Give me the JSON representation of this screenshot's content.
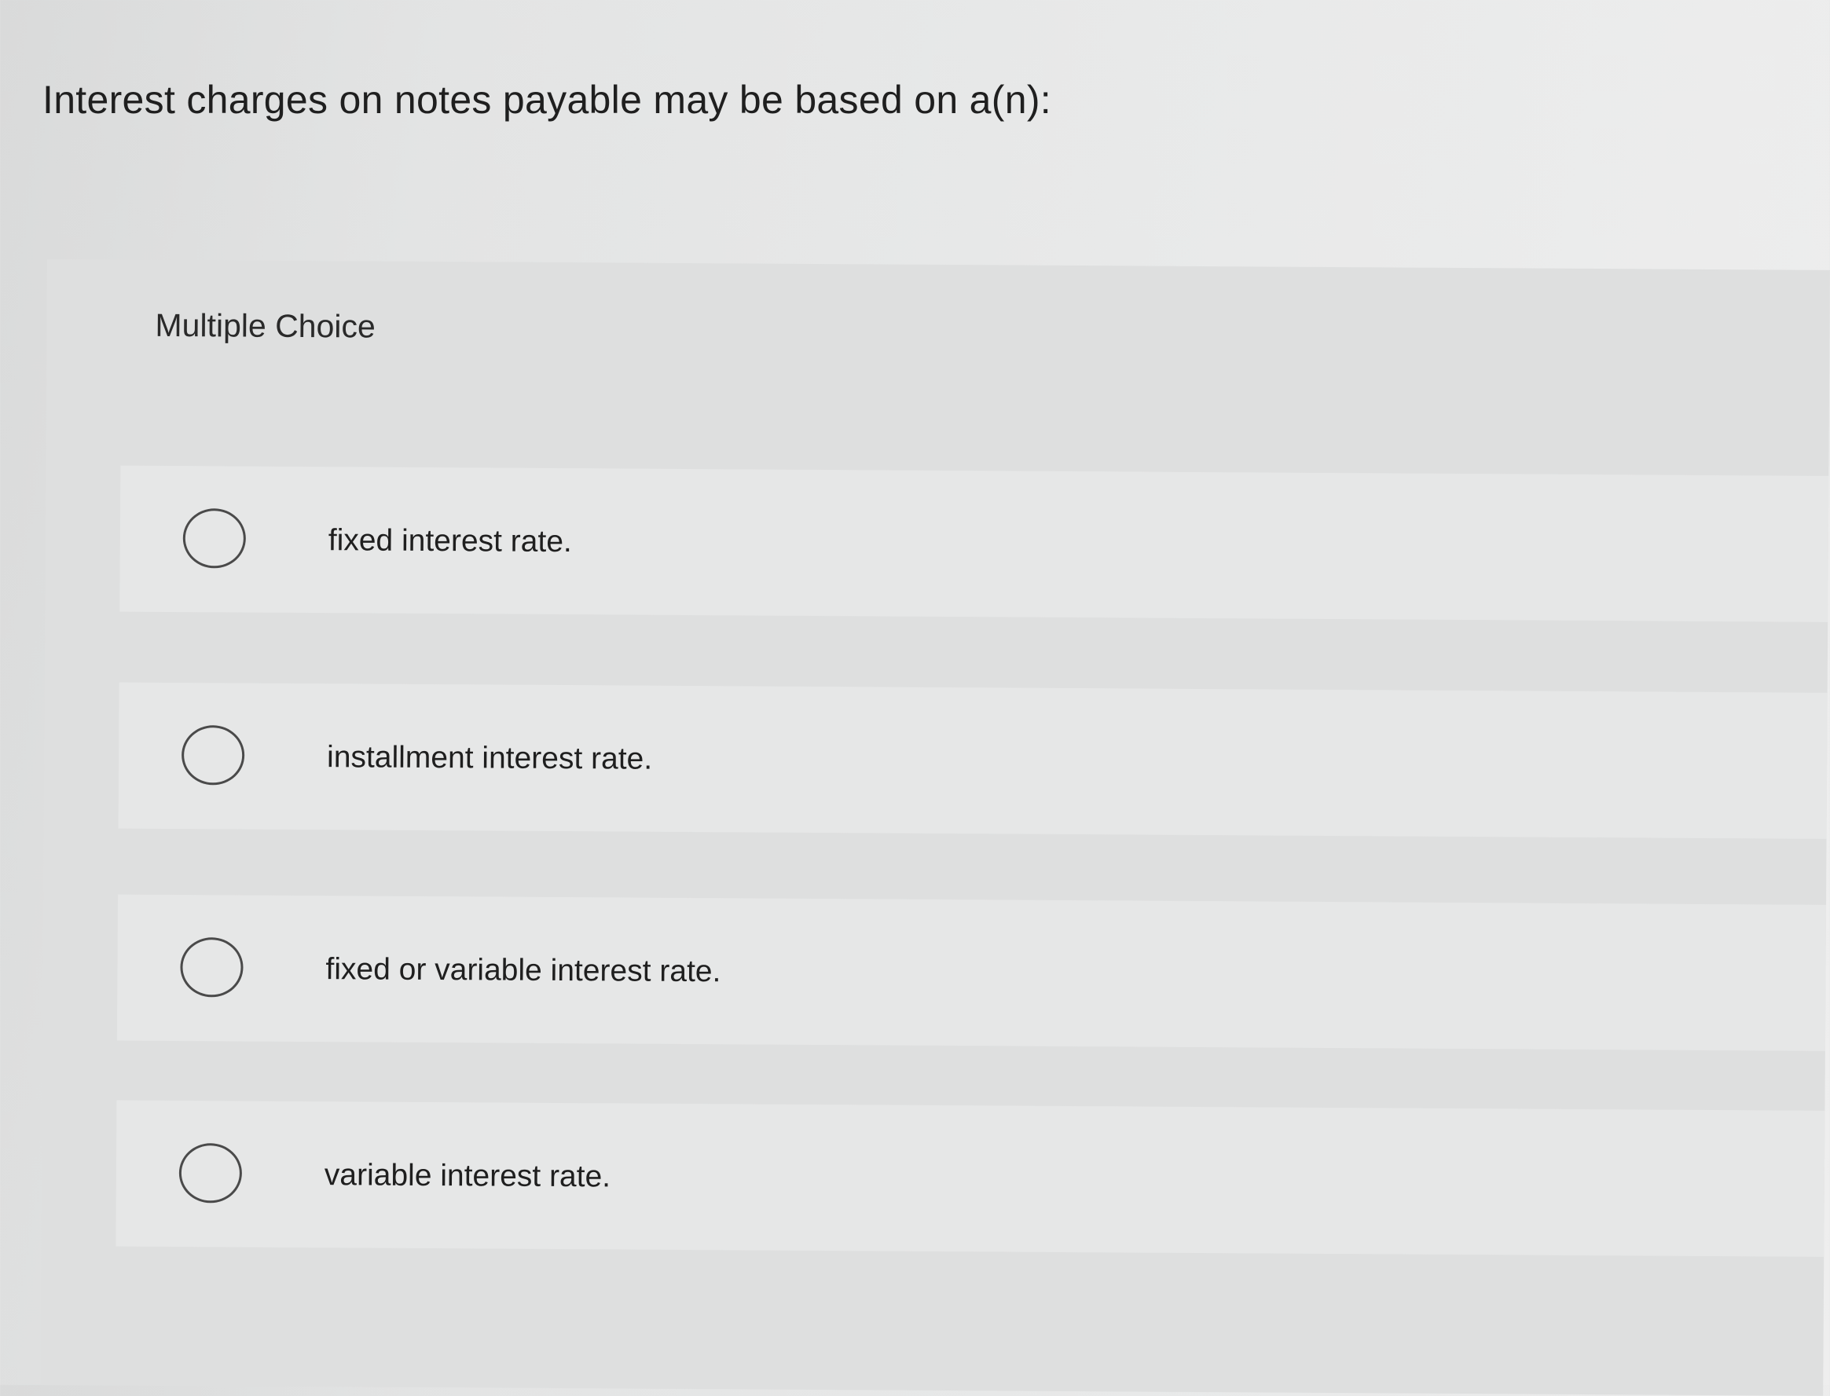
{
  "question": {
    "text": "Interest charges on notes payable may be based on a(n):"
  },
  "question_type": {
    "label": "Multiple Choice"
  },
  "options": [
    {
      "label": "fixed interest rate."
    },
    {
      "label": "installment interest rate."
    },
    {
      "label": "fixed or variable interest rate."
    },
    {
      "label": "variable interest rate."
    }
  ]
}
